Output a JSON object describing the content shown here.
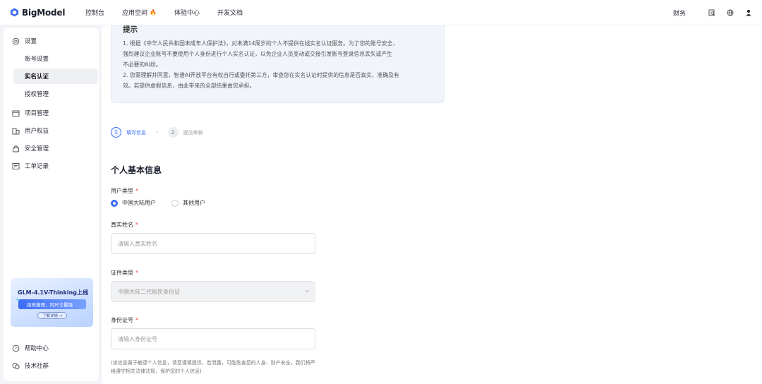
{
  "header": {
    "logo_text": "BigModel",
    "nav": [
      "控制台",
      "应用空间",
      "体验中心",
      "开发文档"
    ],
    "finance": "财务",
    "icons": [
      "search-doc-icon",
      "globe-icon",
      "user-icon"
    ],
    "accent": "#3d6cf5"
  },
  "sidebar": {
    "settings": "设置",
    "account_settings": "账号设置",
    "real_name": "实名认证",
    "authorization": "授权管理",
    "projects": "项目管理",
    "benefits": "用户权益",
    "security": "安全管理",
    "tickets": "工单记录",
    "promo_title": "GLM-4.1V-Thinking上线",
    "promo_sub": "视觉推理，同尺寸最强",
    "promo_btn": "了解详情 →",
    "help": "帮助中心",
    "community": "技术社群"
  },
  "notice": {
    "title": "提示",
    "lines": [
      "1. 根据《中华人民共和国未成年人保护法》，对未满14周岁的个人不提供在线实名认证服务。为了您的账号安全，",
      "强烈建议企业账号不要使用个人身份进行个人实名认证，以免企业人员变动或交接引发账号登录信息丢失或产生",
      "不必要的纠纷。",
      "2. 您需理解并同意，智谱AI开放平台有权自行或委托第三方，审查您在实名认证时提供的信息是否真实、准确及有",
      "效。若提供虚假信息，由此带来的全部结果由您承担。"
    ]
  },
  "steps": [
    {
      "num": "1",
      "label": "填写信息"
    },
    {
      "num": "2",
      "label": "提交审核"
    }
  ],
  "form": {
    "section_title": "个人基本信息",
    "user_type_label": "用户类型",
    "user_type_options": [
      "中国大陆用户",
      "其他用户"
    ],
    "name_label": "真实姓名",
    "name_placeholder": "请输入真实姓名",
    "id_type_label": "证件类型",
    "id_type_value": "中国大陆二代居民身份证",
    "id_number_label": "身份证号",
    "id_number_placeholder": "请输入身份证号",
    "hint": "(该信息属于敏感个人信息，请您谨慎提供，若泄露，可能危害您的人身、财产安全，我们将严格遵守相关法律法规，保护您的个人信息)",
    "required_mark": "*"
  }
}
